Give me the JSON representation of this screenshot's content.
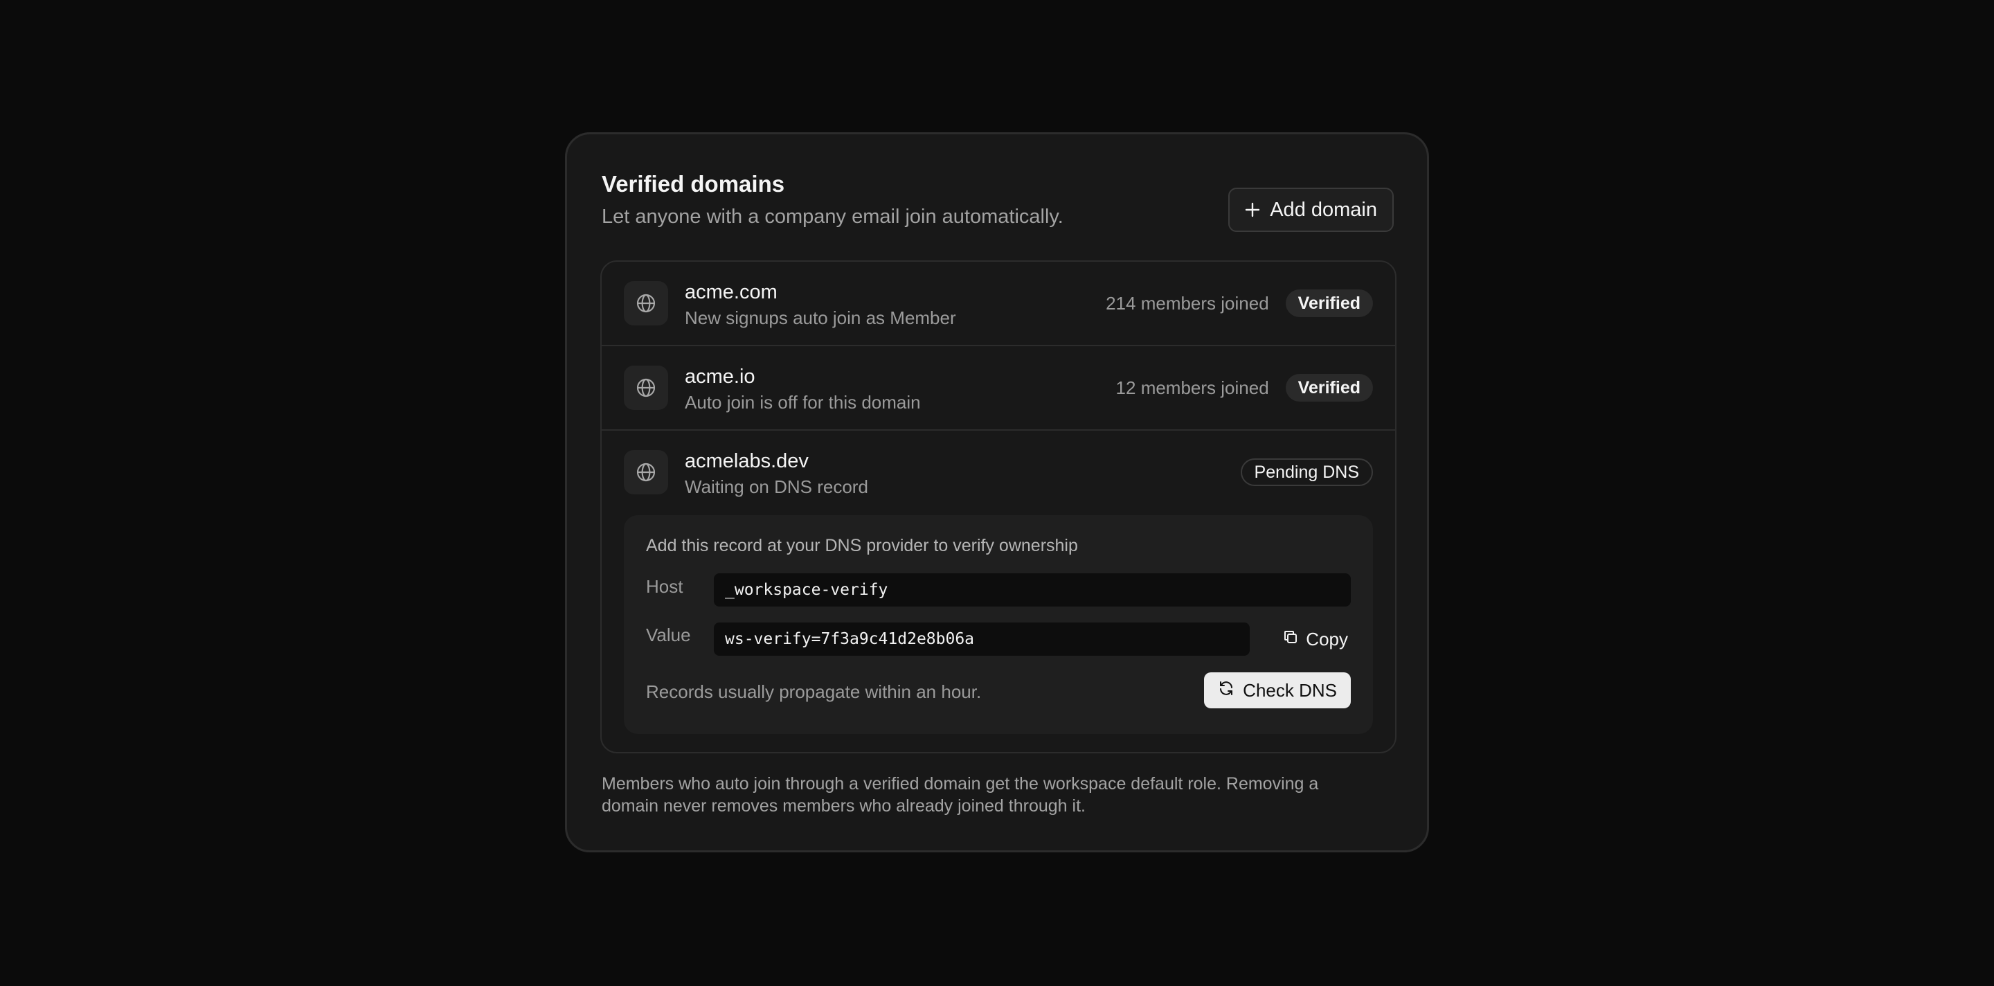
{
  "header": {
    "title": "Verified domains",
    "subtitle": "Let anyone with a company email join automatically.",
    "add_button_label": "Add domain"
  },
  "domains": [
    {
      "name": "acme.com",
      "description": "New signups auto join as Member",
      "members": "214 members joined",
      "status": "Verified"
    },
    {
      "name": "acme.io",
      "description": "Auto join is off for this domain",
      "members": "12 members joined",
      "status": "Verified"
    },
    {
      "name": "acmelabs.dev",
      "description": "Waiting on DNS record",
      "status": "Pending DNS"
    }
  ],
  "dns": {
    "intro": "Add this record at your DNS provider to verify ownership",
    "host_label": "Host",
    "host_value": "_workspace-verify",
    "value_label": "Value",
    "value_value": "ws-verify=7f3a9c41d2e8b06a",
    "copy_label": "Copy",
    "propagate_note": "Records usually propagate within an hour.",
    "check_button_label": "Check DNS"
  },
  "footer": {
    "note": "Members who auto join through a verified domain get the workspace default role. Removing a domain never removes members who already joined through it."
  },
  "icons": {
    "add": "plus-icon",
    "domain": "globe-icon",
    "copy": "copy-icon",
    "refresh": "refresh-icon"
  },
  "colors": {
    "background": "#0b0b0b",
    "card": "#181818",
    "border": "#2c2c2c",
    "text_primary": "#f5f5f5",
    "text_secondary": "#9b9b9b",
    "field_bg": "#0d0d0d",
    "primary_button_bg": "#ececec"
  }
}
